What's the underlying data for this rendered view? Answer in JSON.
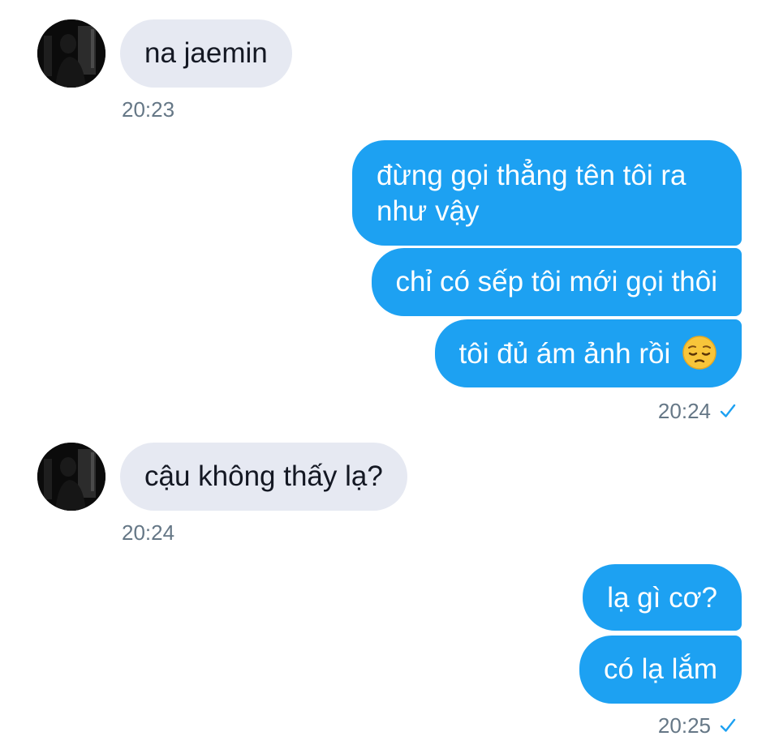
{
  "contact": {
    "name": "na jaemin"
  },
  "messages": [
    {
      "text": "na jaemin"
    },
    {
      "text": "đừng gọi thẳng tên tôi ra như vậy"
    },
    {
      "text": "chỉ có sếp tôi mới gọi thôi"
    },
    {
      "text": "tôi đủ ám ảnh rồi",
      "emoji": "pensive-face"
    },
    {
      "text": "cậu không thấy lạ?"
    },
    {
      "text": "lạ gì cơ?"
    },
    {
      "text": "có lạ lắm"
    }
  ],
  "timestamps": [
    "20:23",
    "20:24",
    "20:24",
    "20:25"
  ],
  "status_icons": [
    "read-check-icon"
  ],
  "colors": {
    "outgoing_bubble": "#1da1f2",
    "incoming_bubble": "#e6e9f2",
    "timestamp": "#657786",
    "check": "#1da1f2"
  }
}
